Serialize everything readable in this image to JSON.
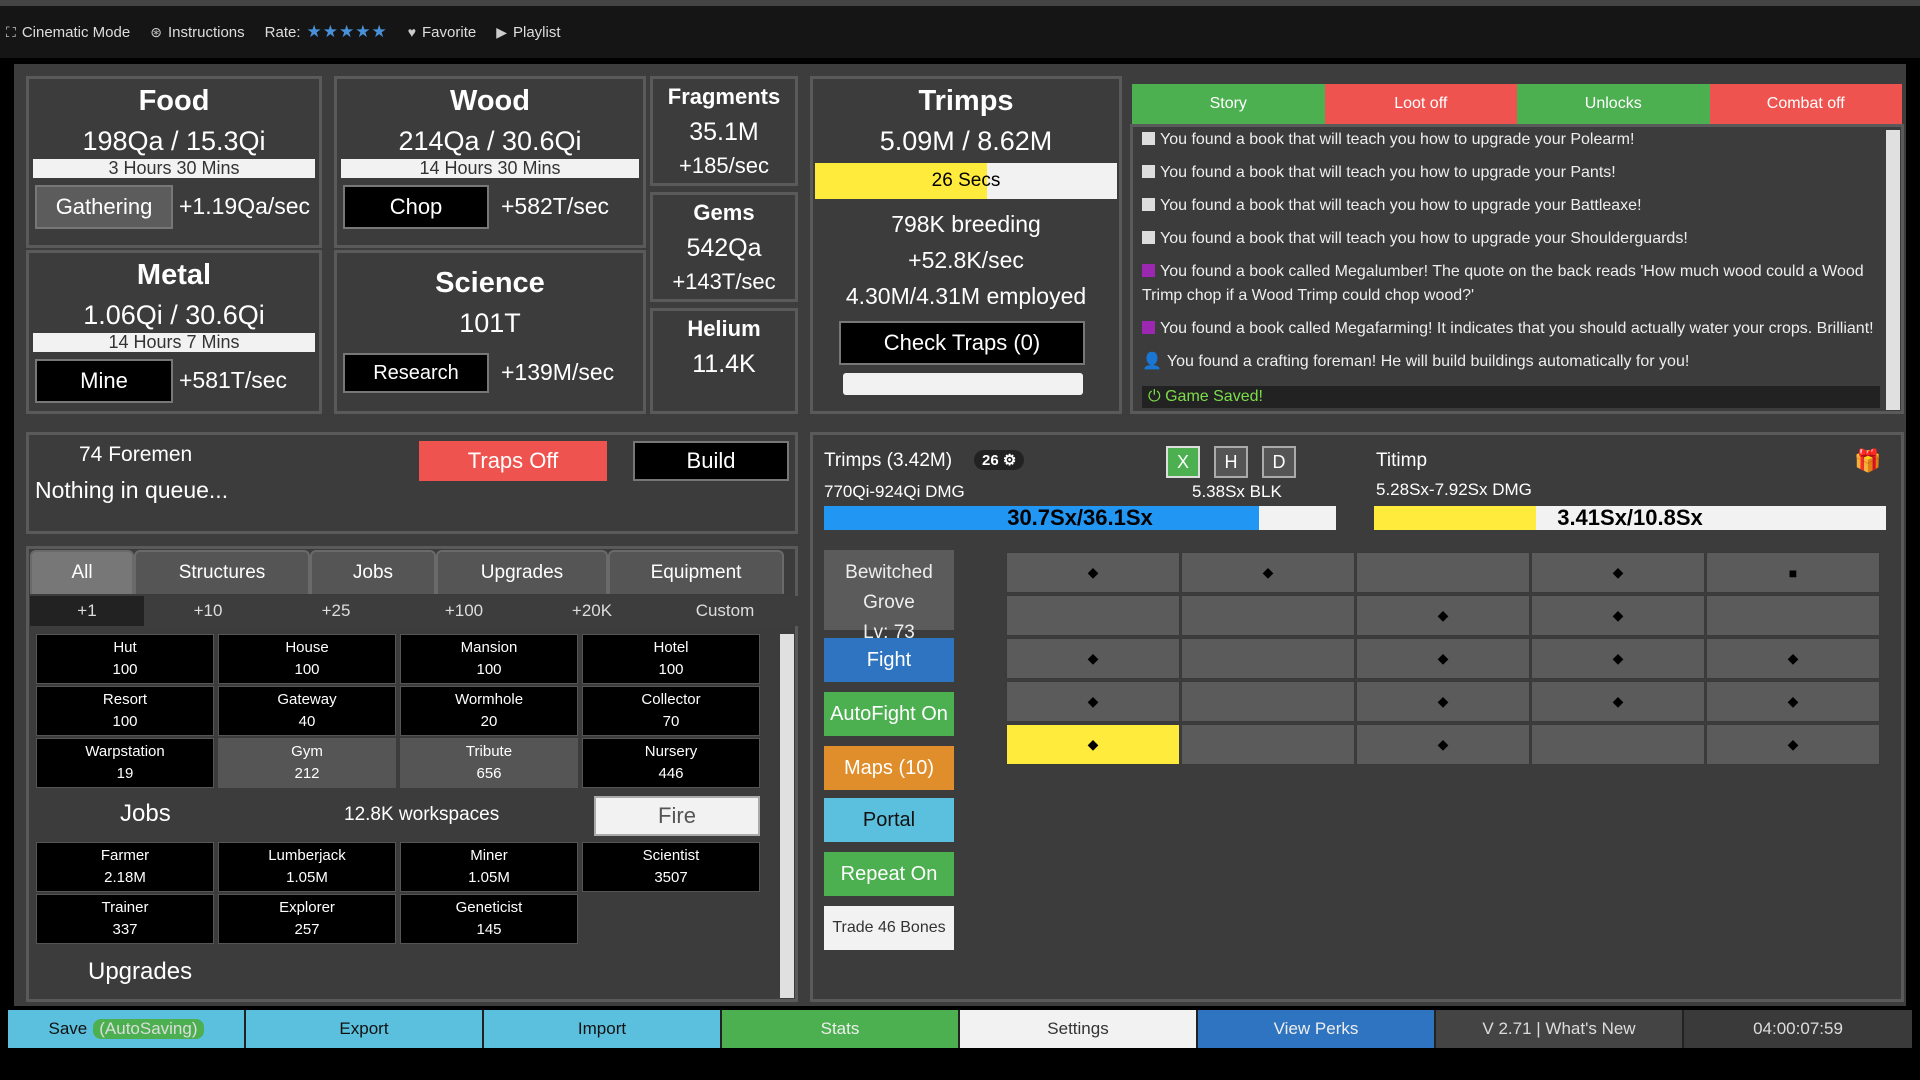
{
  "topbar": {
    "cinematic": "Cinematic Mode",
    "instructions": "Instructions",
    "rate": "Rate:",
    "stars": "★★★★★",
    "favorite": "Favorite",
    "playlist": "Playlist"
  },
  "resources": {
    "food": {
      "title": "Food",
      "value": "198Qa / 15.3Qi",
      "time": "3 Hours 30 Mins",
      "button": "Gathering",
      "rate": "+1.19Qa/sec"
    },
    "wood": {
      "title": "Wood",
      "value": "214Qa / 30.6Qi",
      "time": "14 Hours 30 Mins",
      "button": "Chop",
      "rate": "+582T/sec"
    },
    "metal": {
      "title": "Metal",
      "value": "1.06Qi / 30.6Qi",
      "time": "14 Hours 7 Mins",
      "button": "Mine",
      "rate": "+581T/sec"
    },
    "science": {
      "title": "Science",
      "value": "101T",
      "button": "Research",
      "rate": "+139M/sec"
    }
  },
  "small": {
    "fragments": {
      "title": "Fragments",
      "value": "35.1M",
      "rate": "+185/sec"
    },
    "gems": {
      "title": "Gems",
      "value": "542Qa",
      "rate": "+143T/sec"
    },
    "helium": {
      "title": "Helium",
      "value": "11.4K"
    }
  },
  "trimps_panel": {
    "title": "Trimps",
    "value": "5.09M / 8.62M",
    "timer": "26 Secs",
    "breeding": "798K breeding",
    "rate": "+52.8K/sec",
    "employed": "4.30M/4.31M employed",
    "check_traps": "Check Traps (0)"
  },
  "log_tabs": {
    "story": "Story",
    "loot": "Loot off",
    "unlocks": "Unlocks",
    "combat": "Combat off"
  },
  "log": [
    "You found a book that will teach you how to upgrade your Polearm!",
    "You found a book that will teach you how to upgrade your Pants!",
    "You found a book that will teach you how to upgrade your Battleaxe!",
    "You found a book that will teach you how to upgrade your Shoulderguards!",
    "You found a book called Megalumber! The quote on the back reads 'How much wood could a Wood Trimp chop if a Wood Trimp could chop wood?'",
    "You found a book called Megafarming! It indicates that you should actually water your crops. Brilliant!",
    "You found a crafting foreman! He will build buildings automatically for you!"
  ],
  "game_saved": "Game Saved!",
  "queue": {
    "foremen": "74 Foremen",
    "status": "Nothing in queue...",
    "traps": "Traps Off",
    "build": "Build"
  },
  "tabs": {
    "all": "All",
    "structures": "Structures",
    "jobs": "Jobs",
    "upgrades": "Upgrades",
    "equipment": "Equipment"
  },
  "qty": [
    "+1",
    "+10",
    "+25",
    "+100",
    "+20K",
    "Custom"
  ],
  "buildings": [
    {
      "name": "Hut",
      "count": "100"
    },
    {
      "name": "House",
      "count": "100"
    },
    {
      "name": "Mansion",
      "count": "100"
    },
    {
      "name": "Hotel",
      "count": "100"
    },
    {
      "name": "Resort",
      "count": "100"
    },
    {
      "name": "Gateway",
      "count": "40"
    },
    {
      "name": "Wormhole",
      "count": "20"
    },
    {
      "name": "Collector",
      "count": "70"
    },
    {
      "name": "Warpstation",
      "count": "19"
    },
    {
      "name": "Gym",
      "count": "212"
    },
    {
      "name": "Tribute",
      "count": "656"
    },
    {
      "name": "Nursery",
      "count": "446"
    }
  ],
  "jobs_section": {
    "title": "Jobs",
    "workspaces": "12.8K workspaces",
    "fire": "Fire"
  },
  "jobs": [
    {
      "name": "Farmer",
      "count": "2.18M"
    },
    {
      "name": "Lumberjack",
      "count": "1.05M"
    },
    {
      "name": "Miner",
      "count": "1.05M"
    },
    {
      "name": "Scientist",
      "count": "3507"
    },
    {
      "name": "Trainer",
      "count": "337"
    },
    {
      "name": "Explorer",
      "count": "257"
    },
    {
      "name": "Geneticist",
      "count": "145"
    }
  ],
  "upgrades_title": "Upgrades",
  "battle": {
    "trimps_label": "Trimps (3.42M)",
    "badge": "26",
    "dmg": "770Qi-924Qi DMG",
    "blk": "5.38Sx BLK",
    "hp_text": "30.7Sx/36.1Sx",
    "hp_fraction": 0.85,
    "enemy": "Titimp",
    "enemy_dmg": "5.28Sx-7.92Sx DMG",
    "enemy_hp": "3.41Sx/10.8Sx",
    "enemy_fraction": 0.316,
    "x": "X",
    "h": "H",
    "d": "D"
  },
  "map": {
    "name": "Bewitched Grove",
    "level": "Lv: 73"
  },
  "battle_buttons": {
    "fight": "Fight",
    "autofight": "AutoFight On",
    "maps": "Maps (10)",
    "portal": "Portal",
    "repeat": "Repeat On",
    "trade": "Trade 46 Bones"
  },
  "grid": [
    [
      "◆",
      "◆",
      "",
      "◆",
      "■"
    ],
    [
      "",
      "",
      "◆",
      "◆",
      ""
    ],
    [
      "◆",
      "",
      "◆",
      "◆",
      "◆"
    ],
    [
      "◆",
      "",
      "◆",
      "◆",
      "◆"
    ],
    [
      "◆",
      "",
      "◆",
      "",
      "◆"
    ]
  ],
  "bottombar": {
    "save": "Save",
    "autosave": "(AutoSaving)",
    "export": "Export",
    "import": "Import",
    "stats": "Stats",
    "settings": "Settings",
    "perks": "View Perks",
    "version": "V 2.71 | What's New",
    "time": "04:00:07:59"
  },
  "colors": {
    "green": "#4caf50",
    "red": "#ef5350",
    "blue": "#2196f3",
    "yellow": "#ffeb3b",
    "orange": "#f39c12",
    "teal": "#5bc0de"
  }
}
